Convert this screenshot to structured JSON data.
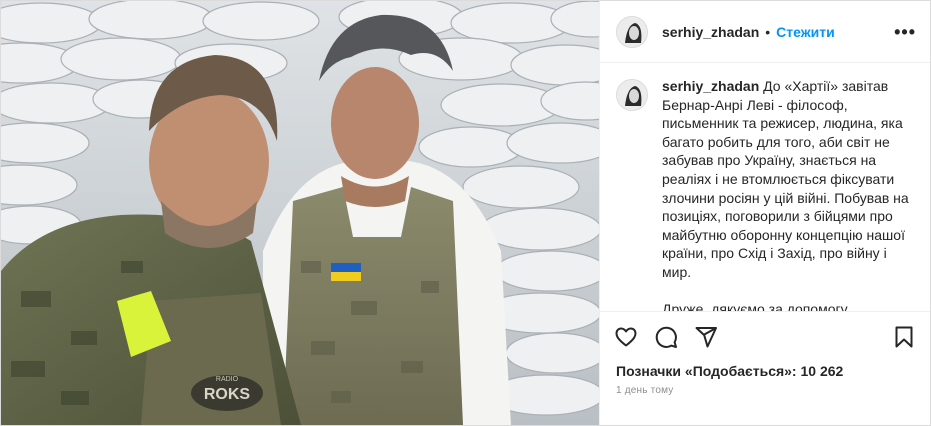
{
  "post": {
    "username": "serhiy_zhadan",
    "separator": "•",
    "follow_label": "Стежити",
    "more_label": "•••",
    "caption_text": "До «Хартії» завітав Бернар-Анрі Леві - філософ, письменник та режисер, людина, яка багато робить для того, аби світ не забував про Україну, знається на реаліях і не втомлюється фіксувати злочини росіян у цій війні. Побував на позиціях, поговорили з бійцями про майбутню оборонну концепцію нашої країни, про Схід і Захід, про війну і мир.",
    "caption_text_2": "Друже, дякуємо за допомогу,",
    "likes_text": "Позначки «Подобається»: 10 262",
    "time_text": "1 день тому"
  },
  "photo": {
    "vest_patch": "ROKS",
    "vest_patch_small": "RADIO"
  },
  "icons": {
    "like": "heart-icon",
    "comment": "comment-icon",
    "share": "share-icon",
    "save": "bookmark-icon"
  },
  "colors": {
    "link": "#0095f6",
    "text": "#262626",
    "muted": "#8e8e8e"
  }
}
